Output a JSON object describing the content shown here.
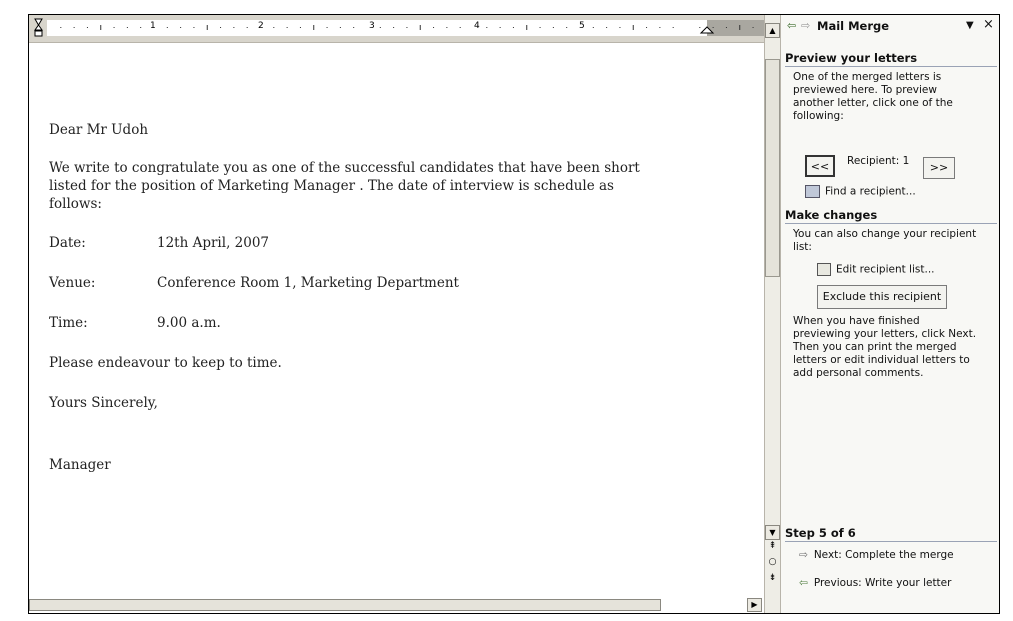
{
  "letter": {
    "salutation": "Dear Mr Udoh",
    "para1": [
      "We write to congratulate you as one of the successful candidates that have been short",
      "listed for the position of  Marketing Manager . The date of interview is schedule as",
      "follows:"
    ],
    "details": [
      {
        "label": "Date:",
        "value": "12th April, 2007"
      },
      {
        "label": "Venue:",
        "value": "Conference Room 1, Marketing Department"
      },
      {
        "label": "Time:",
        "value": "9.00 a.m."
      }
    ],
    "closing_note": "Please endeavour to keep to time.",
    "signoff": "Yours Sincerely,",
    "signature": "Manager"
  },
  "ruler": {
    "numbers": [
      "1",
      "2",
      "3",
      "4",
      "5"
    ]
  },
  "taskpane": {
    "title": "Mail Merge",
    "preview": {
      "heading": "Preview your letters",
      "text": [
        "One of the merged letters is",
        "previewed here. To preview",
        "another letter, click one of the",
        "following:"
      ],
      "prev_label": "<<",
      "recipient_label": "Recipient: 1",
      "next_label": ">>",
      "find_label": "Find a recipient..."
    },
    "changes": {
      "heading": "Make changes",
      "text": [
        "You can also change your recipient",
        "list:"
      ],
      "edit_label": "Edit recipient list...",
      "exclude_label": "Exclude this recipient",
      "finish_text": [
        "When you have finished",
        "previewing your letters, click Next.",
        "Then you can print the merged",
        "letters or edit individual letters to",
        "add personal comments."
      ]
    },
    "step": {
      "heading": "Step 5 of 6",
      "next_label": "Next: Complete the merge",
      "prev_label": "Previous: Write your letter"
    }
  }
}
